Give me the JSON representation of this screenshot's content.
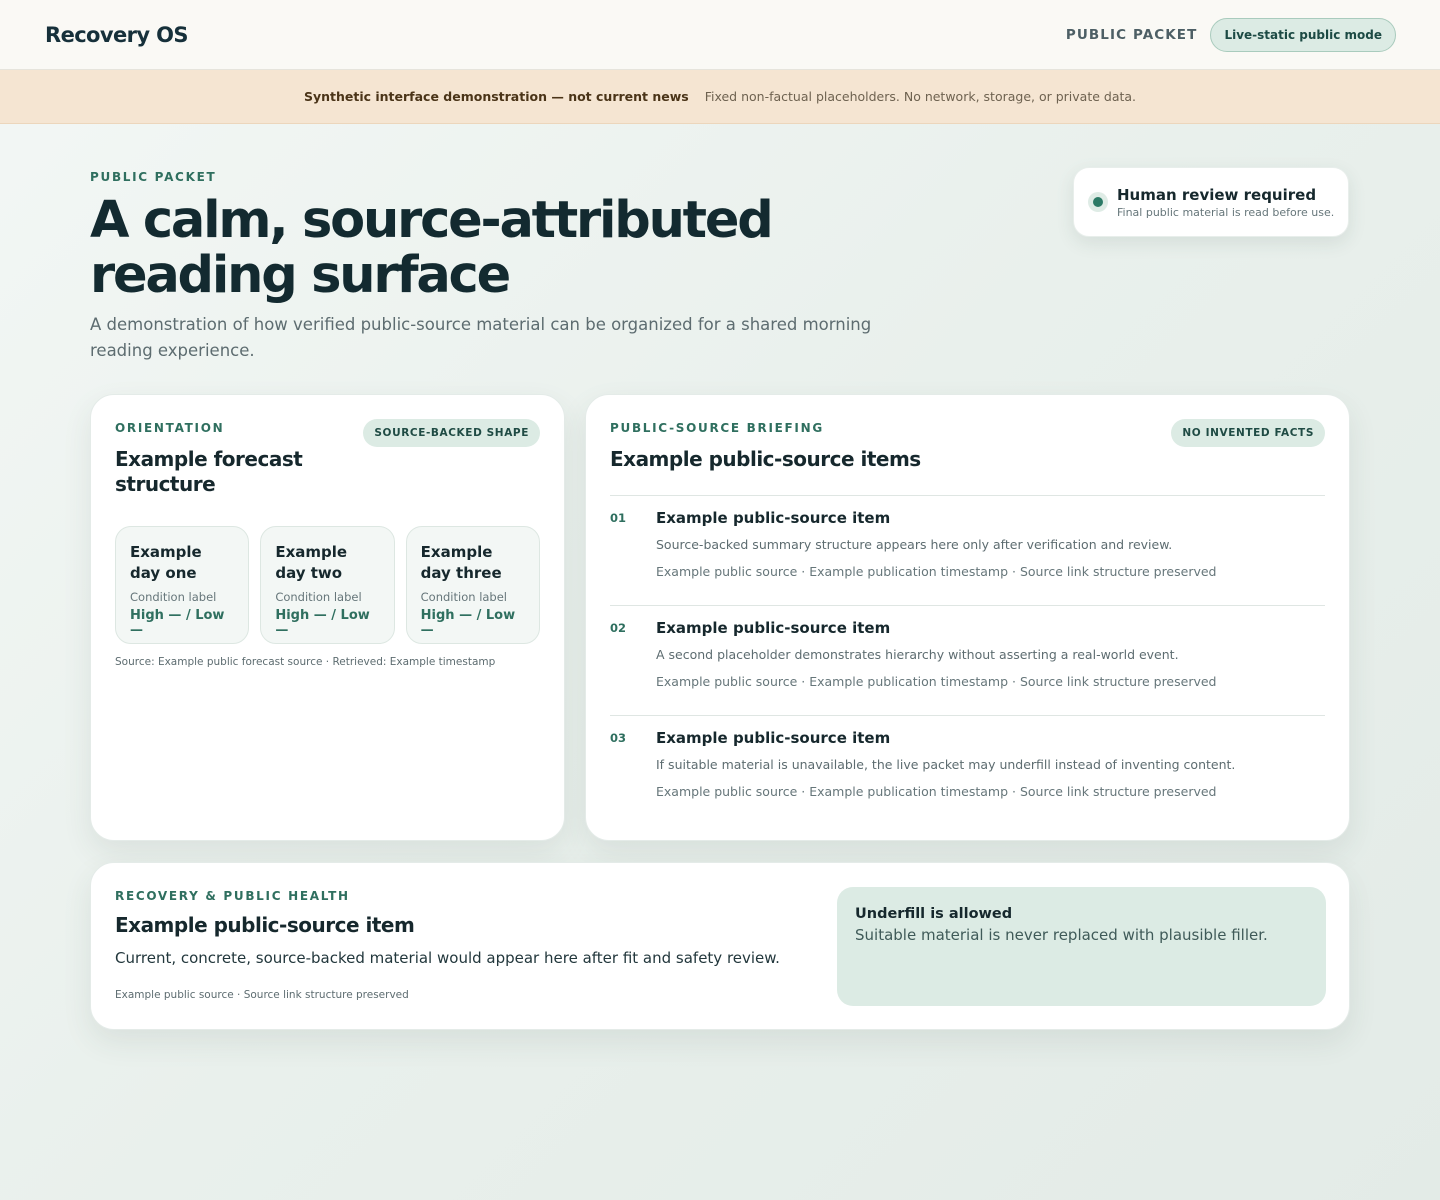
{
  "header": {
    "brand": "Recovery OS",
    "nav_link": "PUBLIC PACKET",
    "mode_pill": "Live-static public mode"
  },
  "banner": {
    "title": "Synthetic interface demonstration — not current news",
    "note": "Fixed non-factual placeholders. No network, storage, or private data."
  },
  "hero": {
    "eyebrow": "PUBLIC PACKET",
    "title": "A calm, source-attributed reading surface",
    "subtitle": "A demonstration of how verified public-source material can be organized for a shared morning reading experience."
  },
  "review": {
    "title": "Human review required",
    "subtitle": "Final public material is read before use."
  },
  "orientation": {
    "eyebrow": "ORIENTATION",
    "tag": "SOURCE-BACKED SHAPE",
    "title": "Example forecast structure",
    "days": [
      {
        "name": "Example day one",
        "condition": "Condition label",
        "temps": "High — / Low —"
      },
      {
        "name": "Example day two",
        "condition": "Condition label",
        "temps": "High — / Low —"
      },
      {
        "name": "Example day three",
        "condition": "Condition label",
        "temps": "High — / Low —"
      }
    ],
    "source": "Source: Example public forecast source · Retrieved: Example timestamp"
  },
  "briefing": {
    "eyebrow": "PUBLIC-SOURCE BRIEFING",
    "tag": "NO INVENTED FACTS",
    "title": "Example public-source items",
    "items": [
      {
        "num": "01",
        "title": "Example public-source item",
        "summary": "Source-backed summary structure appears here only after verification and review.",
        "meta": "Example public source · Example publication timestamp · Source link structure preserved"
      },
      {
        "num": "02",
        "title": "Example public-source item",
        "summary": "A second placeholder demonstrates hierarchy without asserting a real-world event.",
        "meta": "Example public source · Example publication timestamp · Source link structure preserved"
      },
      {
        "num": "03",
        "title": "Example public-source item",
        "summary": "If suitable material is unavailable, the live packet may underfill instead of inventing content.",
        "meta": "Example public source · Example publication timestamp · Source link structure preserved"
      }
    ]
  },
  "recovery": {
    "eyebrow": "RECOVERY & PUBLIC HEALTH",
    "title": "Example public-source item",
    "body": "Current, concrete, source-backed material would appear here after fit and safety review.",
    "source": "Example public source · Source link structure preserved",
    "underfill_title": "Underfill is allowed",
    "underfill_text": "Suitable material is never replaced with plausible filler."
  }
}
